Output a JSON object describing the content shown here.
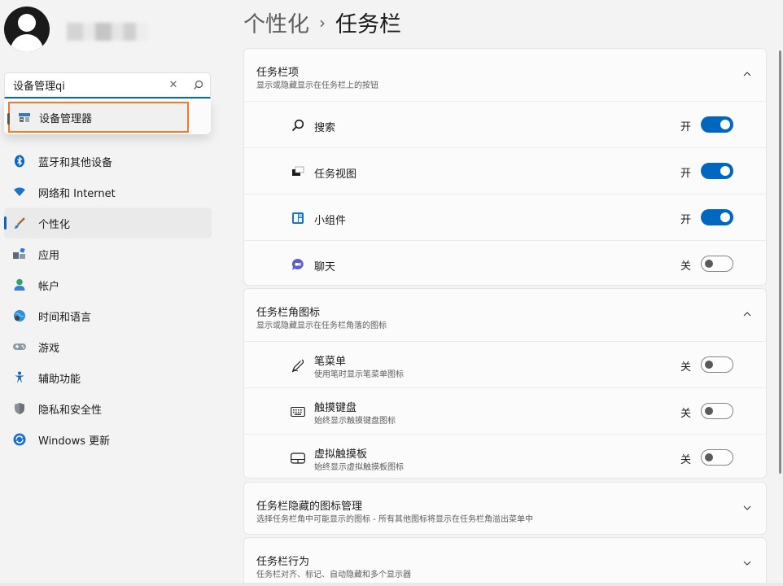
{
  "user": {
    "avatar": "user-avatar-icon",
    "name_blurred": true
  },
  "search": {
    "value": "设备管理qi",
    "clear_icon": "✕",
    "search_icon": "search-icon"
  },
  "suggestions": [
    {
      "label": "设备管理器",
      "icon": "device-manager-icon"
    }
  ],
  "nav": {
    "items": [
      {
        "label": "蓝牙和其他设备",
        "icon": "bluetooth-icon",
        "active": false
      },
      {
        "label": "网络和 Internet",
        "icon": "wifi-icon",
        "active": false
      },
      {
        "label": "个性化",
        "icon": "brush-icon",
        "active": true
      },
      {
        "label": "应用",
        "icon": "apps-icon",
        "active": false
      },
      {
        "label": "帐户",
        "icon": "person-icon",
        "active": false
      },
      {
        "label": "时间和语言",
        "icon": "globe-clock-icon",
        "active": false
      },
      {
        "label": "游戏",
        "icon": "gamepad-icon",
        "active": false
      },
      {
        "label": "辅助功能",
        "icon": "accessibility-icon",
        "active": false
      },
      {
        "label": "隐私和安全性",
        "icon": "shield-icon",
        "active": false
      },
      {
        "label": "Windows 更新",
        "icon": "windows-update-icon",
        "active": false
      }
    ]
  },
  "breadcrumb": {
    "parent": "个性化",
    "separator": "›",
    "current": "任务栏"
  },
  "sections": {
    "taskbar_items": {
      "title": "任务栏项",
      "subtitle": "显示或隐藏显示在任务栏上的按钮",
      "expanded": true,
      "rows": [
        {
          "label": "搜索",
          "icon": "search-icon",
          "state": "开",
          "on": true
        },
        {
          "label": "任务视图",
          "icon": "task-view-icon",
          "state": "开",
          "on": true
        },
        {
          "label": "小组件",
          "icon": "widgets-icon",
          "state": "开",
          "on": true
        },
        {
          "label": "聊天",
          "icon": "chat-icon",
          "state": "关",
          "on": false
        }
      ]
    },
    "corner_icons": {
      "title": "任务栏角图标",
      "subtitle": "显示或隐藏显示在任务栏角落的图标",
      "expanded": true,
      "rows": [
        {
          "label": "笔菜单",
          "sub": "使用笔时显示笔菜单图标",
          "icon": "pen-icon",
          "state": "关",
          "on": false
        },
        {
          "label": "触摸键盘",
          "sub": "始终显示触摸键盘图标",
          "icon": "keyboard-icon",
          "state": "关",
          "on": false
        },
        {
          "label": "虚拟触摸板",
          "sub": "始终显示虚拟触摸板图标",
          "icon": "touchpad-icon",
          "state": "关",
          "on": false
        }
      ]
    },
    "overflow": {
      "title": "任务栏隐藏的图标管理",
      "subtitle": "选择任务栏角中可能显示的图标 - 所有其他图标将显示在任务栏角溢出菜单中",
      "expanded": false
    },
    "behaviors": {
      "title": "任务栏行为",
      "subtitle": "任务栏对齐、标记、自动隐藏和多个显示器",
      "expanded": false
    }
  },
  "colors": {
    "accent": "#0067c0",
    "highlight_border": "#f07a2a",
    "background": "#f3f3f3",
    "card": "#fbfbfb"
  }
}
